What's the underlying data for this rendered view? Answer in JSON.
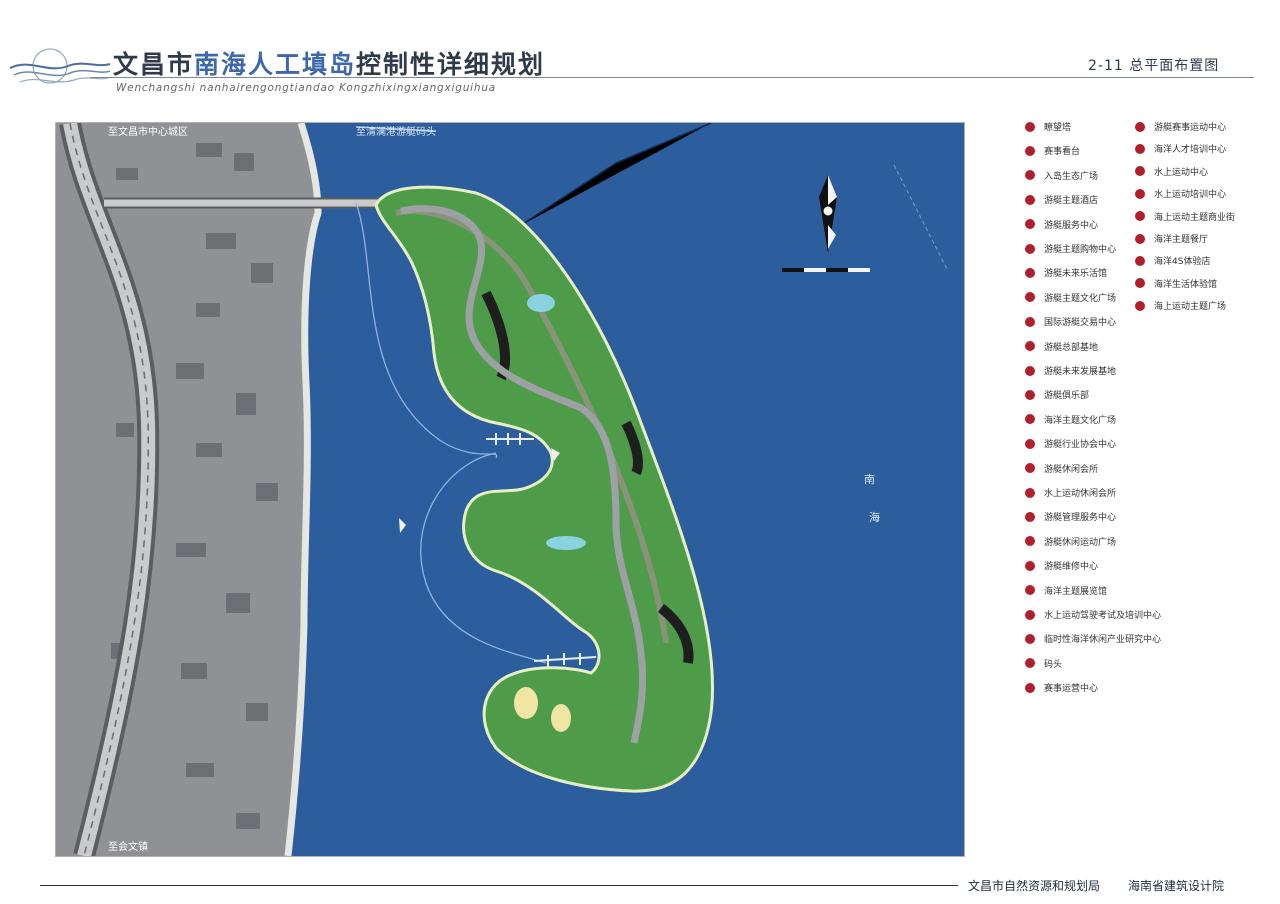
{
  "header": {
    "title_prefix": "文昌市",
    "title_highlight": "南海人工填岛",
    "title_suffix": "控制性详细规划",
    "pinyin": "Wenchangshi nanhairengongtiandao Kongzhixingxiangxiguihua",
    "sheet": "2-11  总平面布置图"
  },
  "map": {
    "label_north_top": "至文昌市中心城区",
    "label_south_bottom": "至会文镇",
    "label_pier": "至清澜港游艇码头",
    "water_label_1": "南",
    "water_label_2": "海"
  },
  "legend": {
    "col1": [
      "瞭望塔",
      "赛事看台",
      "入岛生态广场",
      "游艇主题酒店",
      "游艇服务中心",
      "游艇主题购物中心",
      "游艇未来乐活馆",
      "游艇主题文化广场",
      "国际游艇交易中心",
      "游艇总部基地",
      "游艇未来发展基地",
      "游艇俱乐部",
      "海洋主题文化广场",
      "游艇行业协会中心",
      "游艇休闲会所",
      "水上运动休闲会所",
      "游艇管理服务中心",
      "游艇休闲运动广场",
      "游艇维修中心",
      "海洋主题展览馆",
      "水上运动驾驶考试及培训中心",
      "临时性海洋休闲产业研究中心",
      "码头",
      "赛事运营中心"
    ],
    "col2": [
      "游艇赛事运动中心",
      "海洋人才培训中心",
      "水上运动中心",
      "水上运动培训中心",
      "海上运动主题商业街",
      "海洋主题餐厅",
      "海洋4S体验店",
      "海洋生活体验馆",
      "海上运动主题广场"
    ]
  },
  "footer": {
    "org1": "文昌市自然资源和规划局",
    "org2": "海南省建筑设计院"
  },
  "colors": {
    "sea": "#2c5d9c",
    "land": "#8f9194",
    "legend_dot": "#b21f2a",
    "title_highlight": "#3d68ad"
  }
}
